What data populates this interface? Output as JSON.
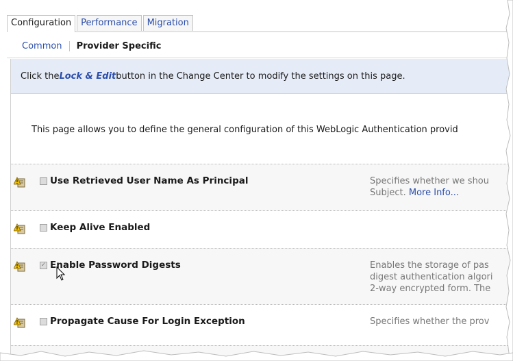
{
  "tabs": [
    {
      "label": "Configuration",
      "active": true
    },
    {
      "label": "Performance",
      "active": false
    },
    {
      "label": "Migration",
      "active": false
    }
  ],
  "subtabs": [
    {
      "label": "Common"
    },
    {
      "label": "Provider Specific"
    }
  ],
  "infobar": {
    "prefix": "Click the ",
    "lock_edit": "Lock & Edit",
    "suffix": " button in the Change Center to modify the settings on this page."
  },
  "description": "This page allows you to define the general configuration of this WebLogic Authentication provid",
  "settings": [
    {
      "label": "Use Retrieved User Name As Principal",
      "help": "Specifies whether we shou",
      "help2": "Subject.",
      "more_info": "More Info...",
      "checked": false
    },
    {
      "label": "Keep Alive Enabled",
      "help": "",
      "checked": false
    },
    {
      "label": "Enable Password Digests",
      "help_lines": [
        "Enables the storage of pas",
        "digest authentication algori",
        "2-way encrypted form. The"
      ],
      "checked": true
    },
    {
      "label": "Propagate Cause For Login Exception",
      "help": "Specifies whether the prov",
      "checked": false
    }
  ],
  "icons": {
    "warning": "warning-book-icon",
    "cursor": "mouse-pointer-icon"
  },
  "colors": {
    "link": "#2b4eac",
    "infobar_bg": "#e6ecf7",
    "row_bg": "#f7f7f7"
  }
}
